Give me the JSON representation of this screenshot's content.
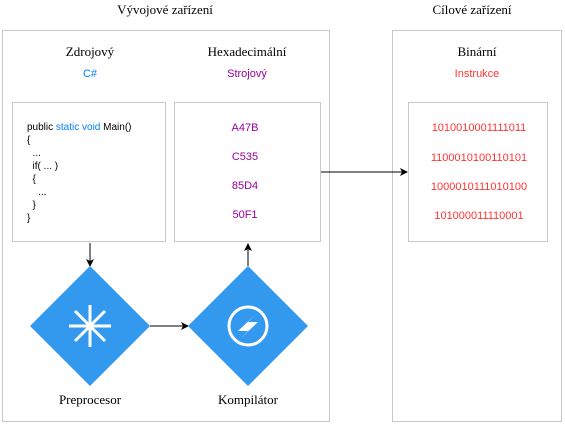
{
  "colors": {
    "accent_blue": "#007FFF",
    "accent_purple": "#990099",
    "accent_red": "#FF3333",
    "diamond": "#3399EE",
    "border": "#C8C8C8",
    "arrow": "#000000"
  },
  "dev_env": {
    "title": "Vývojové zařízení",
    "source": {
      "title": "Zdrojový",
      "language": "C#",
      "code": {
        "line1_a": "public ",
        "line1_kw": "static void",
        "line1_b": " Main()",
        "line2": "{",
        "line3": "  ...",
        "line4": "  if( ... )",
        "line5": "  {",
        "line6": "    ...",
        "line7": "  }",
        "line8": "}"
      }
    },
    "hex": {
      "title": "Hexadecimální",
      "subtitle": "Strojový",
      "values": [
        "A47B",
        "C535",
        "85D4",
        "50F1"
      ]
    },
    "preprocessor": {
      "label": "Preprocesor",
      "icon": "asterisk-icon"
    },
    "compiler": {
      "label": "Kompilátor",
      "icon": "lightning-icon"
    }
  },
  "target": {
    "title": "Cílové zařízení",
    "binary": {
      "title": "Binární",
      "subtitle": "Instrukce",
      "values": [
        "1010010001111011",
        "1100010100110101",
        "1000010111010100",
        "101000011110001"
      ]
    }
  }
}
